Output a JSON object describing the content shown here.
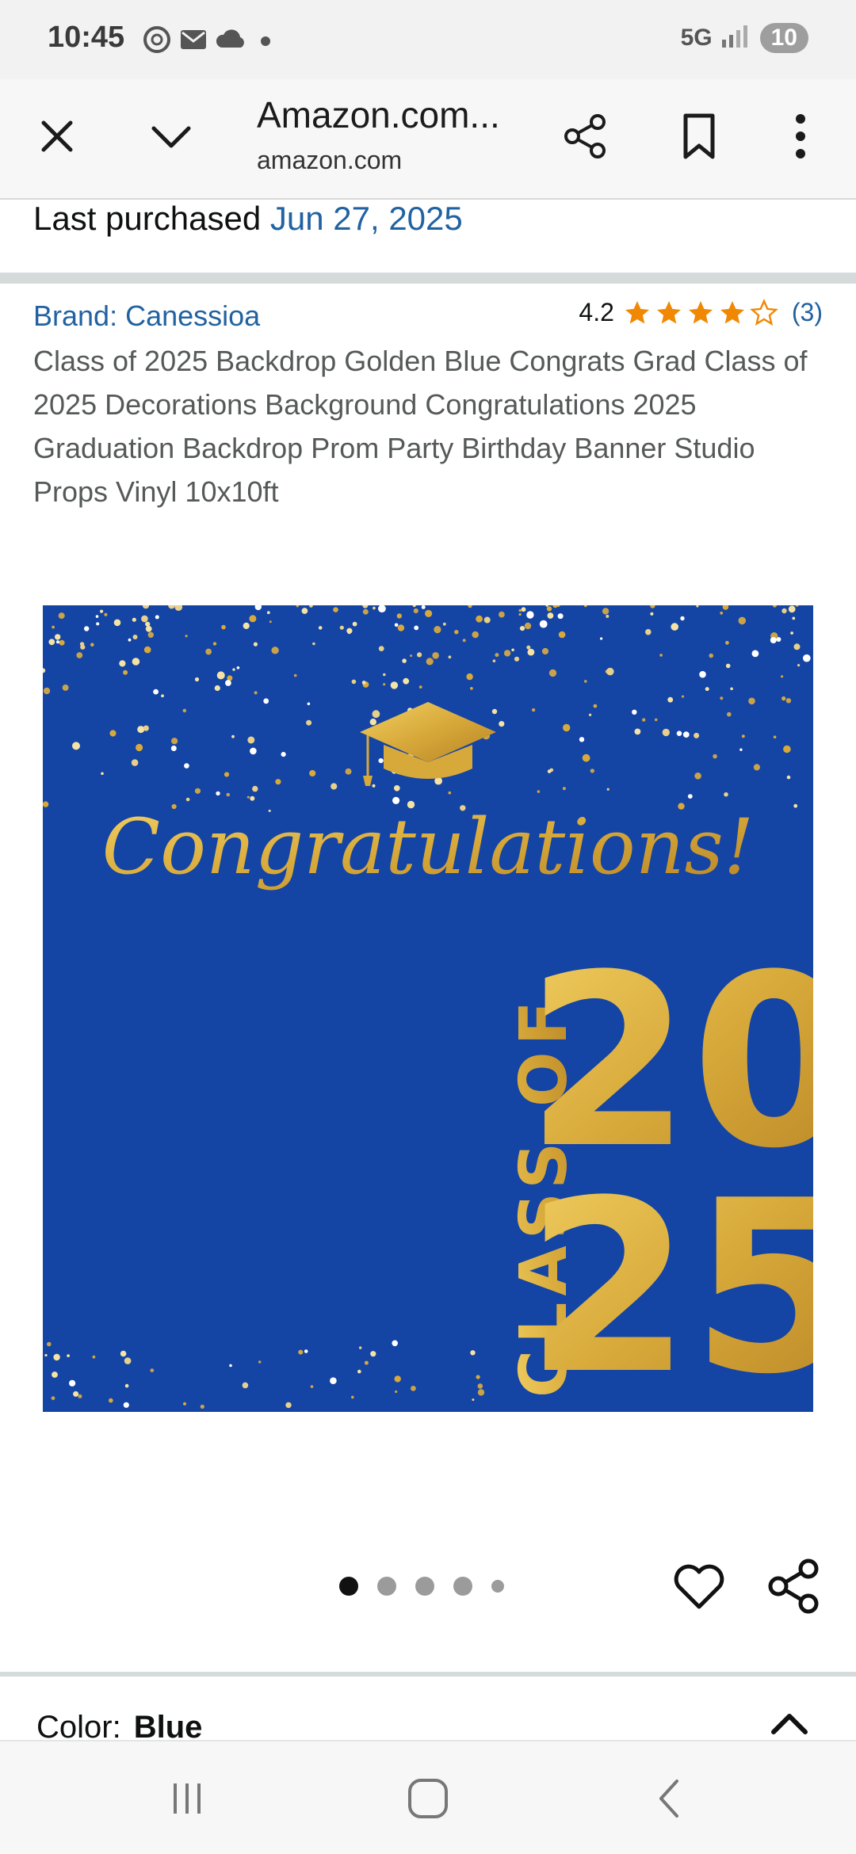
{
  "status_bar": {
    "time": "10:45",
    "network": "5G",
    "battery": "10",
    "icons_left": [
      "threads-icon",
      "mail-icon",
      "cloud-icon",
      "dot-icon"
    ]
  },
  "browser": {
    "title": "Amazon.com...",
    "domain": "amazon.com",
    "icons": [
      "close-icon",
      "chevron-down-icon",
      "share-icon",
      "bookmark-icon",
      "more-vert-icon"
    ]
  },
  "purchase": {
    "label": "Last purchased ",
    "date": "Jun 27, 2025"
  },
  "product": {
    "brand": "Brand: Canessioa",
    "rating": "4.2",
    "rating_value": 4.2,
    "star_count": 5,
    "review_count": "(3)",
    "title": "Class of 2025 Backdrop Golden Blue Congrats Grad Class of 2025 Decorations Background Congratulations 2025 Graduation Backdrop Prom Party Birthday Banner Studio Props Vinyl 10x10ft",
    "image": {
      "headline": "Congratulations!",
      "class_label": "CLASS OF",
      "year_top": "20",
      "year_bottom": "25",
      "background_color": "#1444a4",
      "gold_color": "#d7a93a"
    }
  },
  "carousel": {
    "total": 5,
    "active_index": 0
  },
  "variation": {
    "label": "Color:",
    "value": "Blue"
  },
  "colors": {
    "link": "#2162a1",
    "star": "#f08804",
    "text_secondary": "#565959"
  }
}
